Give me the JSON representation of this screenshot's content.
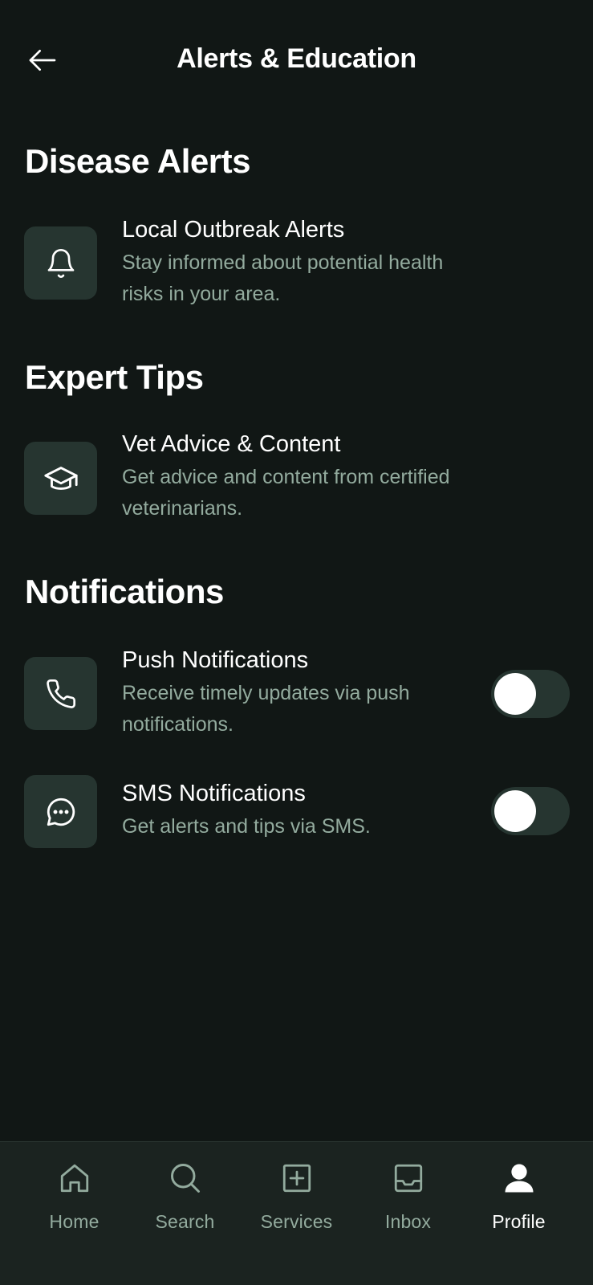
{
  "header": {
    "title": "Alerts & Education",
    "back_icon": "arrow-left-icon"
  },
  "sections": [
    {
      "title": "Disease Alerts",
      "items": [
        {
          "icon": "bell-icon",
          "title": "Local Outbreak Alerts",
          "desc": "Stay informed about potential health risks in your area."
        }
      ]
    },
    {
      "title": "Expert Tips",
      "items": [
        {
          "icon": "graduation-cap-icon",
          "title": "Vet Advice & Content",
          "desc": "Get advice and content from certified veterinarians."
        }
      ]
    },
    {
      "title": "Notifications",
      "items": [
        {
          "icon": "phone-icon",
          "title": "Push Notifications",
          "desc": "Receive timely updates via push notifications.",
          "toggle": "off"
        },
        {
          "icon": "chat-bubble-icon",
          "title": "SMS Notifications",
          "desc": "Get alerts and tips via SMS.",
          "toggle": "off"
        }
      ]
    }
  ],
  "nav": {
    "items": [
      {
        "label": "Home",
        "icon": "home-icon"
      },
      {
        "label": "Search",
        "icon": "search-icon"
      },
      {
        "label": "Services",
        "icon": "plus-square-icon"
      },
      {
        "label": "Inbox",
        "icon": "inbox-icon"
      },
      {
        "label": "Profile",
        "icon": "user-icon",
        "active": true
      }
    ]
  },
  "colors": {
    "background": "#111715",
    "card": "#263530",
    "muted_text": "#93ab9e",
    "nav_background": "#1b2320"
  }
}
